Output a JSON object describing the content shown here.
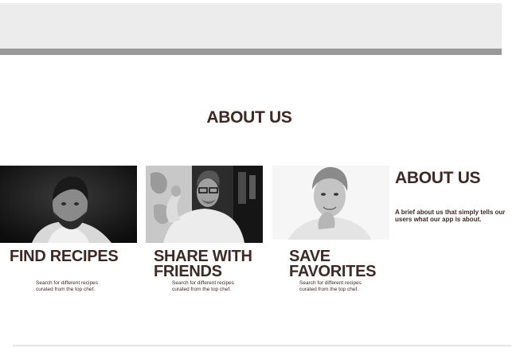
{
  "header": {},
  "section": {
    "title": "ABOUT US"
  },
  "cards": [
    {
      "heading": "FIND RECIPES",
      "description": "Search for different recipes curated from the top chef."
    },
    {
      "heading": "SHARE WITH FRIENDS",
      "description": "Search for different recipes curated from the top chef."
    },
    {
      "heading": "SAVE FAVORITES",
      "description": "Search for different recipes curated from the top chef."
    }
  ],
  "about": {
    "heading": "ABOUT US",
    "text": "A brief about us that simply tells our users what our app is about."
  },
  "colors": {
    "heading": "#3b2a26",
    "header_bg": "#ececec",
    "header_rule": "#999999"
  }
}
